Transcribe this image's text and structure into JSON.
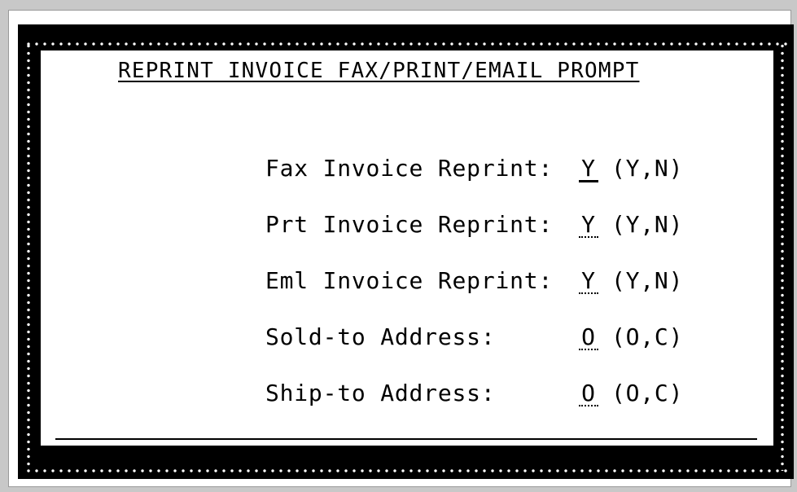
{
  "prompt": {
    "title": "REPRINT INVOICE FAX/PRINT/EMAIL PROMPT",
    "fields": [
      {
        "label": "Fax Invoice Reprint:",
        "value": "Y",
        "options": "(Y,N)"
      },
      {
        "label": "Prt Invoice Reprint:",
        "value": "Y",
        "options": "(Y,N)"
      },
      {
        "label": "Eml Invoice Reprint:",
        "value": "Y",
        "options": "(Y,N)"
      },
      {
        "label": "Sold-to Address:",
        "value": "O",
        "options": "(O,C)"
      },
      {
        "label": "Ship-to Address:",
        "value": "O",
        "options": "(O,C)"
      }
    ]
  },
  "colors": {
    "background": "#c8c8c8",
    "frame": "#000000",
    "panel": "#ffffff"
  }
}
